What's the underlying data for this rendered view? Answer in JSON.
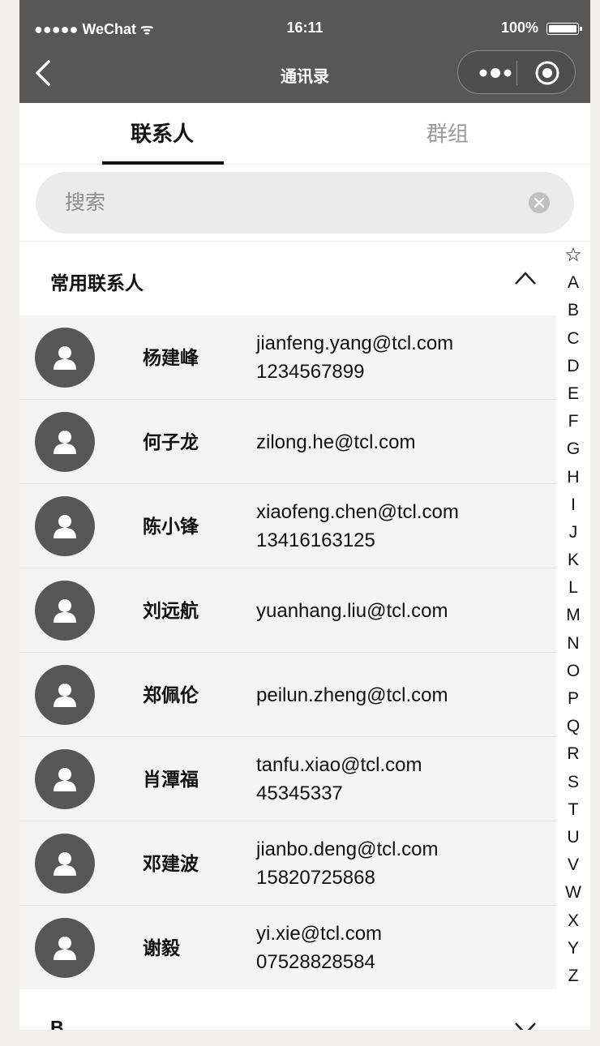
{
  "status_bar": {
    "carrier": "●●●●● WeChat ᯤ",
    "time": "16:11",
    "battery": "100%"
  },
  "nav": {
    "title": "通讯录"
  },
  "tabs": [
    {
      "label": "联系人"
    },
    {
      "label": "群组"
    }
  ],
  "search": {
    "placeholder": "搜索",
    "value": ""
  },
  "section": {
    "title": "常用联系人"
  },
  "contacts": [
    {
      "name": "杨建峰",
      "email": "jianfeng.yang@tcl.com",
      "phone": "1234567899"
    },
    {
      "name": "何子龙",
      "email": "zilong.he@tcl.com",
      "phone": ""
    },
    {
      "name": "陈小锋",
      "email": "xiaofeng.chen@tcl.com",
      "phone": "13416163125"
    },
    {
      "name": "刘远航",
      "email": "yuanhang.liu@tcl.com",
      "phone": ""
    },
    {
      "name": "郑佩伦",
      "email": "peilun.zheng@tcl.com",
      "phone": ""
    },
    {
      "name": "肖潭福",
      "email": "tanfu.xiao@tcl.com",
      "phone": "45345337"
    },
    {
      "name": "邓建波",
      "email": "jianbo.deng@tcl.com",
      "phone": "15820725868"
    },
    {
      "name": "谢毅",
      "email": "yi.xie@tcl.com",
      "phone": "07528828584"
    }
  ],
  "section_b": {
    "title": "B"
  },
  "index": [
    "☆",
    "A",
    "B",
    "C",
    "D",
    "E",
    "F",
    "G",
    "H",
    "I",
    "J",
    "K",
    "L",
    "M",
    "N",
    "O",
    "P",
    "Q",
    "R",
    "S",
    "T",
    "U",
    "V",
    "W",
    "X",
    "Y",
    "Z"
  ],
  "colors": {
    "nav_bg": "#575757",
    "row_bg": "#f4f4f4",
    "avatar_bg": "#575757",
    "search_bg": "#ebebeb"
  }
}
